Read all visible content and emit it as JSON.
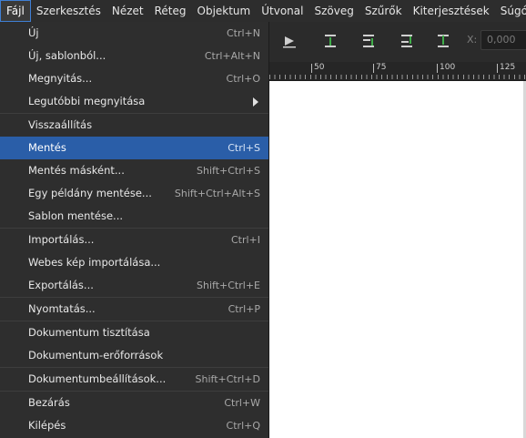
{
  "menubar": {
    "items": [
      {
        "label": "Fájl",
        "active": true
      },
      {
        "label": "Szerkesztés"
      },
      {
        "label": "Nézet"
      },
      {
        "label": "Réteg"
      },
      {
        "label": "Objektum"
      },
      {
        "label": "Útvonal"
      },
      {
        "label": "Szöveg"
      },
      {
        "label": "Szűrők"
      },
      {
        "label": "Kiterjesztések"
      },
      {
        "label": "Súgó"
      }
    ]
  },
  "toolbar": {
    "x_label": "X:",
    "x_value": "0,000"
  },
  "ruler": {
    "labels": [
      "50",
      "75",
      "100",
      "125"
    ]
  },
  "file_menu": {
    "items": [
      {
        "label": "Új",
        "shortcut": "Ctrl+N"
      },
      {
        "label": "Új, sablonból...",
        "shortcut": "Ctrl+Alt+N"
      },
      {
        "label": "Megnyitás...",
        "shortcut": "Ctrl+O"
      },
      {
        "label": "Legutóbbi megnyitása",
        "shortcut": ""
      },
      {
        "label": "Visszaállítás",
        "shortcut": ""
      },
      {
        "label": "Mentés",
        "shortcut": "Ctrl+S"
      },
      {
        "label": "Mentés másként...",
        "shortcut": "Shift+Ctrl+S"
      },
      {
        "label": "Egy példány mentése...",
        "shortcut": "Shift+Ctrl+Alt+S"
      },
      {
        "label": "Sablon mentése...",
        "shortcut": ""
      },
      {
        "label": "Importálás...",
        "shortcut": "Ctrl+I"
      },
      {
        "label": "Webes kép importálása...",
        "shortcut": ""
      },
      {
        "label": "Exportálás...",
        "shortcut": "Shift+Ctrl+E"
      },
      {
        "label": "Nyomtatás...",
        "shortcut": "Ctrl+P"
      },
      {
        "label": "Dokumentum tisztítása",
        "shortcut": ""
      },
      {
        "label": "Dokumentum-erőforrások",
        "shortcut": ""
      },
      {
        "label": "Dokumentumbeállítások...",
        "shortcut": "Shift+Ctrl+D"
      },
      {
        "label": "Bezárás",
        "shortcut": "Ctrl+W"
      },
      {
        "label": "Kilépés",
        "shortcut": "Ctrl+Q"
      }
    ]
  },
  "colors": {
    "highlight": "#2a5ea8",
    "menu_bg": "#2e2e2e",
    "accent_green": "#3fae49"
  }
}
